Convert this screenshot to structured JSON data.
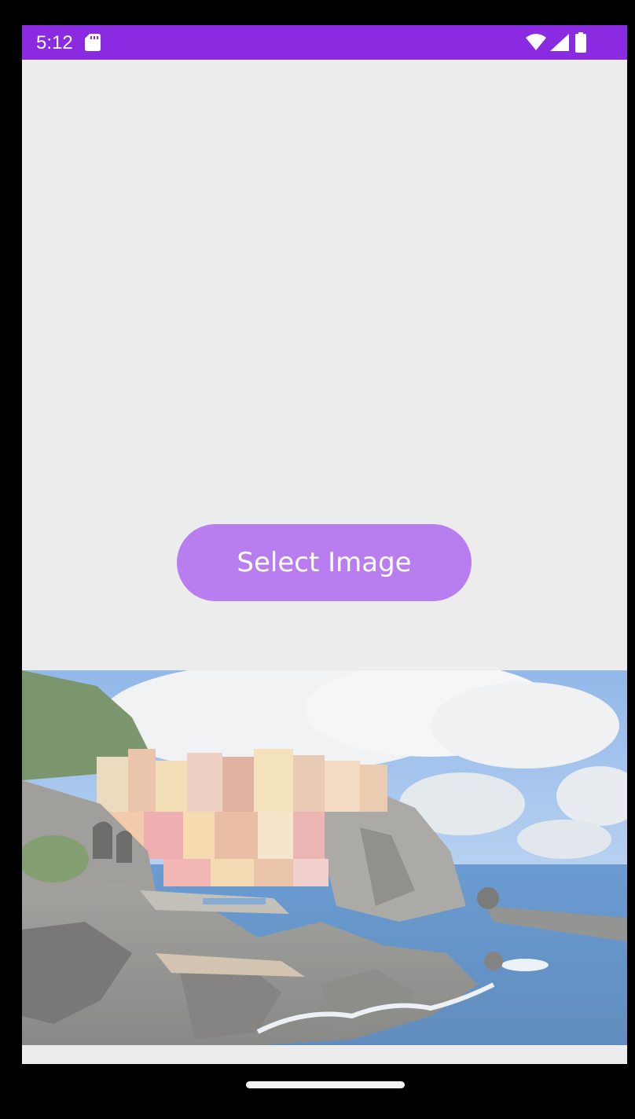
{
  "status_bar": {
    "time": "5:12",
    "background": "#8a2be2",
    "icons": [
      "sd-card-icon",
      "wifi-icon",
      "signal-icon",
      "battery-icon"
    ]
  },
  "main": {
    "background": "#ececec",
    "select_button": {
      "label": "Select Image",
      "color": "#b87ef0"
    },
    "photo": {
      "subject": "coastal-village-photo"
    }
  },
  "navigation": {
    "handle_color": "#f2f2f2"
  }
}
